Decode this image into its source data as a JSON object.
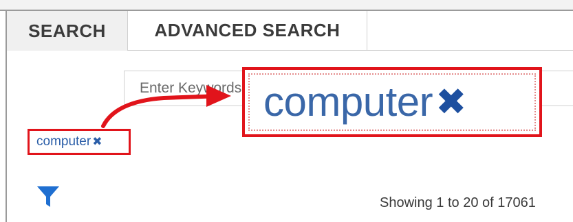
{
  "tabs": [
    {
      "label": "SEARCH",
      "active": true
    },
    {
      "label": "ADVANCED SEARCH",
      "active": false
    }
  ],
  "search": {
    "placeholder": "Enter Keywords",
    "value": ""
  },
  "token": {
    "label": "computer",
    "remove_glyph": "✖",
    "icon": "close-icon"
  },
  "results": {
    "showing_text": "Showing 1 to 20 of 17061"
  },
  "filter": {
    "icon": "filter-icon"
  },
  "colors": {
    "annotation_red": "#e1141b",
    "token_blue": "#2b5ea8",
    "filter_blue": "#1f6fd1"
  }
}
